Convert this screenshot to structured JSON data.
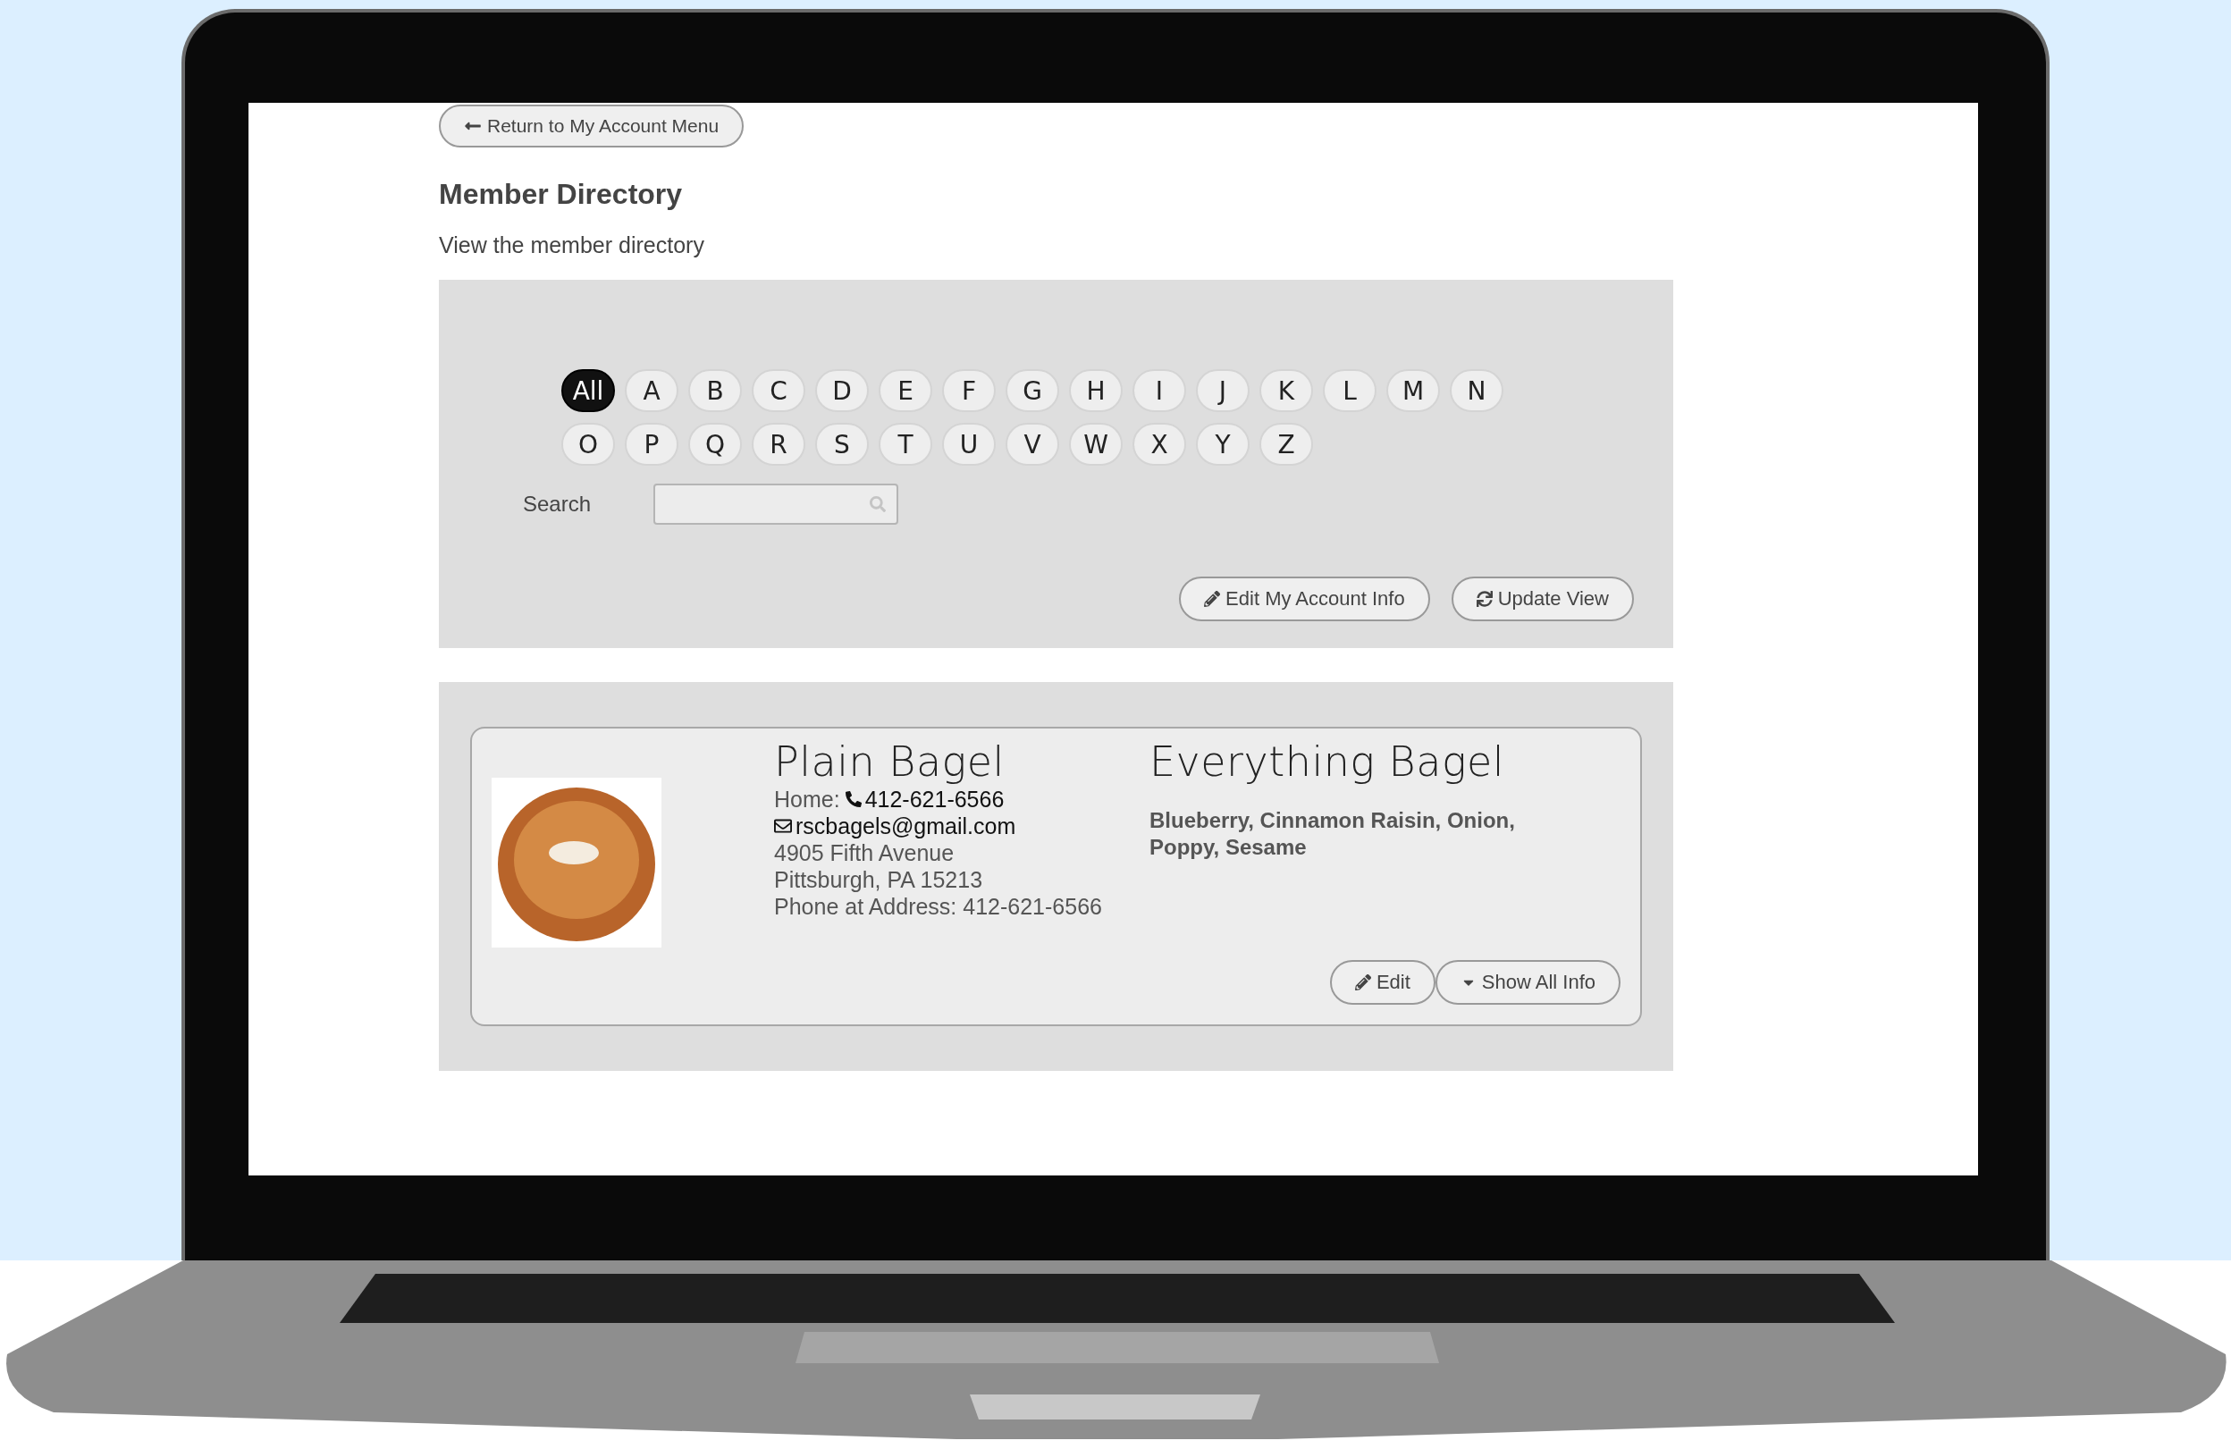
{
  "back_button": {
    "label": "Return to My Account Menu"
  },
  "title": "Member Directory",
  "subtitle": "View the member directory",
  "letter_rows": [
    [
      {
        "label": "All",
        "selected": true
      },
      {
        "label": "A",
        "selected": false
      },
      {
        "label": "B",
        "selected": false
      },
      {
        "label": "C",
        "selected": false
      },
      {
        "label": "D",
        "selected": false
      },
      {
        "label": "E",
        "selected": false
      },
      {
        "label": "F",
        "selected": false
      },
      {
        "label": "G",
        "selected": false
      },
      {
        "label": "H",
        "selected": false
      },
      {
        "label": "I",
        "selected": false
      },
      {
        "label": "J",
        "selected": false
      },
      {
        "label": "K",
        "selected": false
      },
      {
        "label": "L",
        "selected": false
      },
      {
        "label": "M",
        "selected": false
      },
      {
        "label": "N",
        "selected": false
      }
    ],
    [
      {
        "label": "O",
        "selected": false
      },
      {
        "label": "P",
        "selected": false
      },
      {
        "label": "Q",
        "selected": false
      },
      {
        "label": "R",
        "selected": false
      },
      {
        "label": "S",
        "selected": false
      },
      {
        "label": "T",
        "selected": false
      },
      {
        "label": "U",
        "selected": false
      },
      {
        "label": "V",
        "selected": false
      },
      {
        "label": "W",
        "selected": false
      },
      {
        "label": "X",
        "selected": false
      },
      {
        "label": "Y",
        "selected": false
      },
      {
        "label": "Z",
        "selected": false
      }
    ]
  ],
  "search": {
    "label": "Search"
  },
  "actions": [
    {
      "kind": "edit",
      "label": "Edit My Account Info"
    },
    {
      "kind": "refresh",
      "label": "Update View"
    }
  ],
  "members": [
    {
      "name": "Plain Bagel",
      "home_label": "Home:",
      "phone": "412-621-6566",
      "email": "rscbagels@gmail.com",
      "address_lines": [
        "4905 Fifth Avenue",
        "Pittsburgh, PA 15213",
        "Phone at Address: 412-621-6566"
      ],
      "business_name": "Everything Bagel",
      "varieties": "Blueberry, Cinnamon Raisin, Onion, Poppy, Sesame",
      "buttons": [
        {
          "kind": "edit",
          "label": "Edit"
        },
        {
          "kind": "expand",
          "label": "Show All Info"
        }
      ]
    }
  ]
}
